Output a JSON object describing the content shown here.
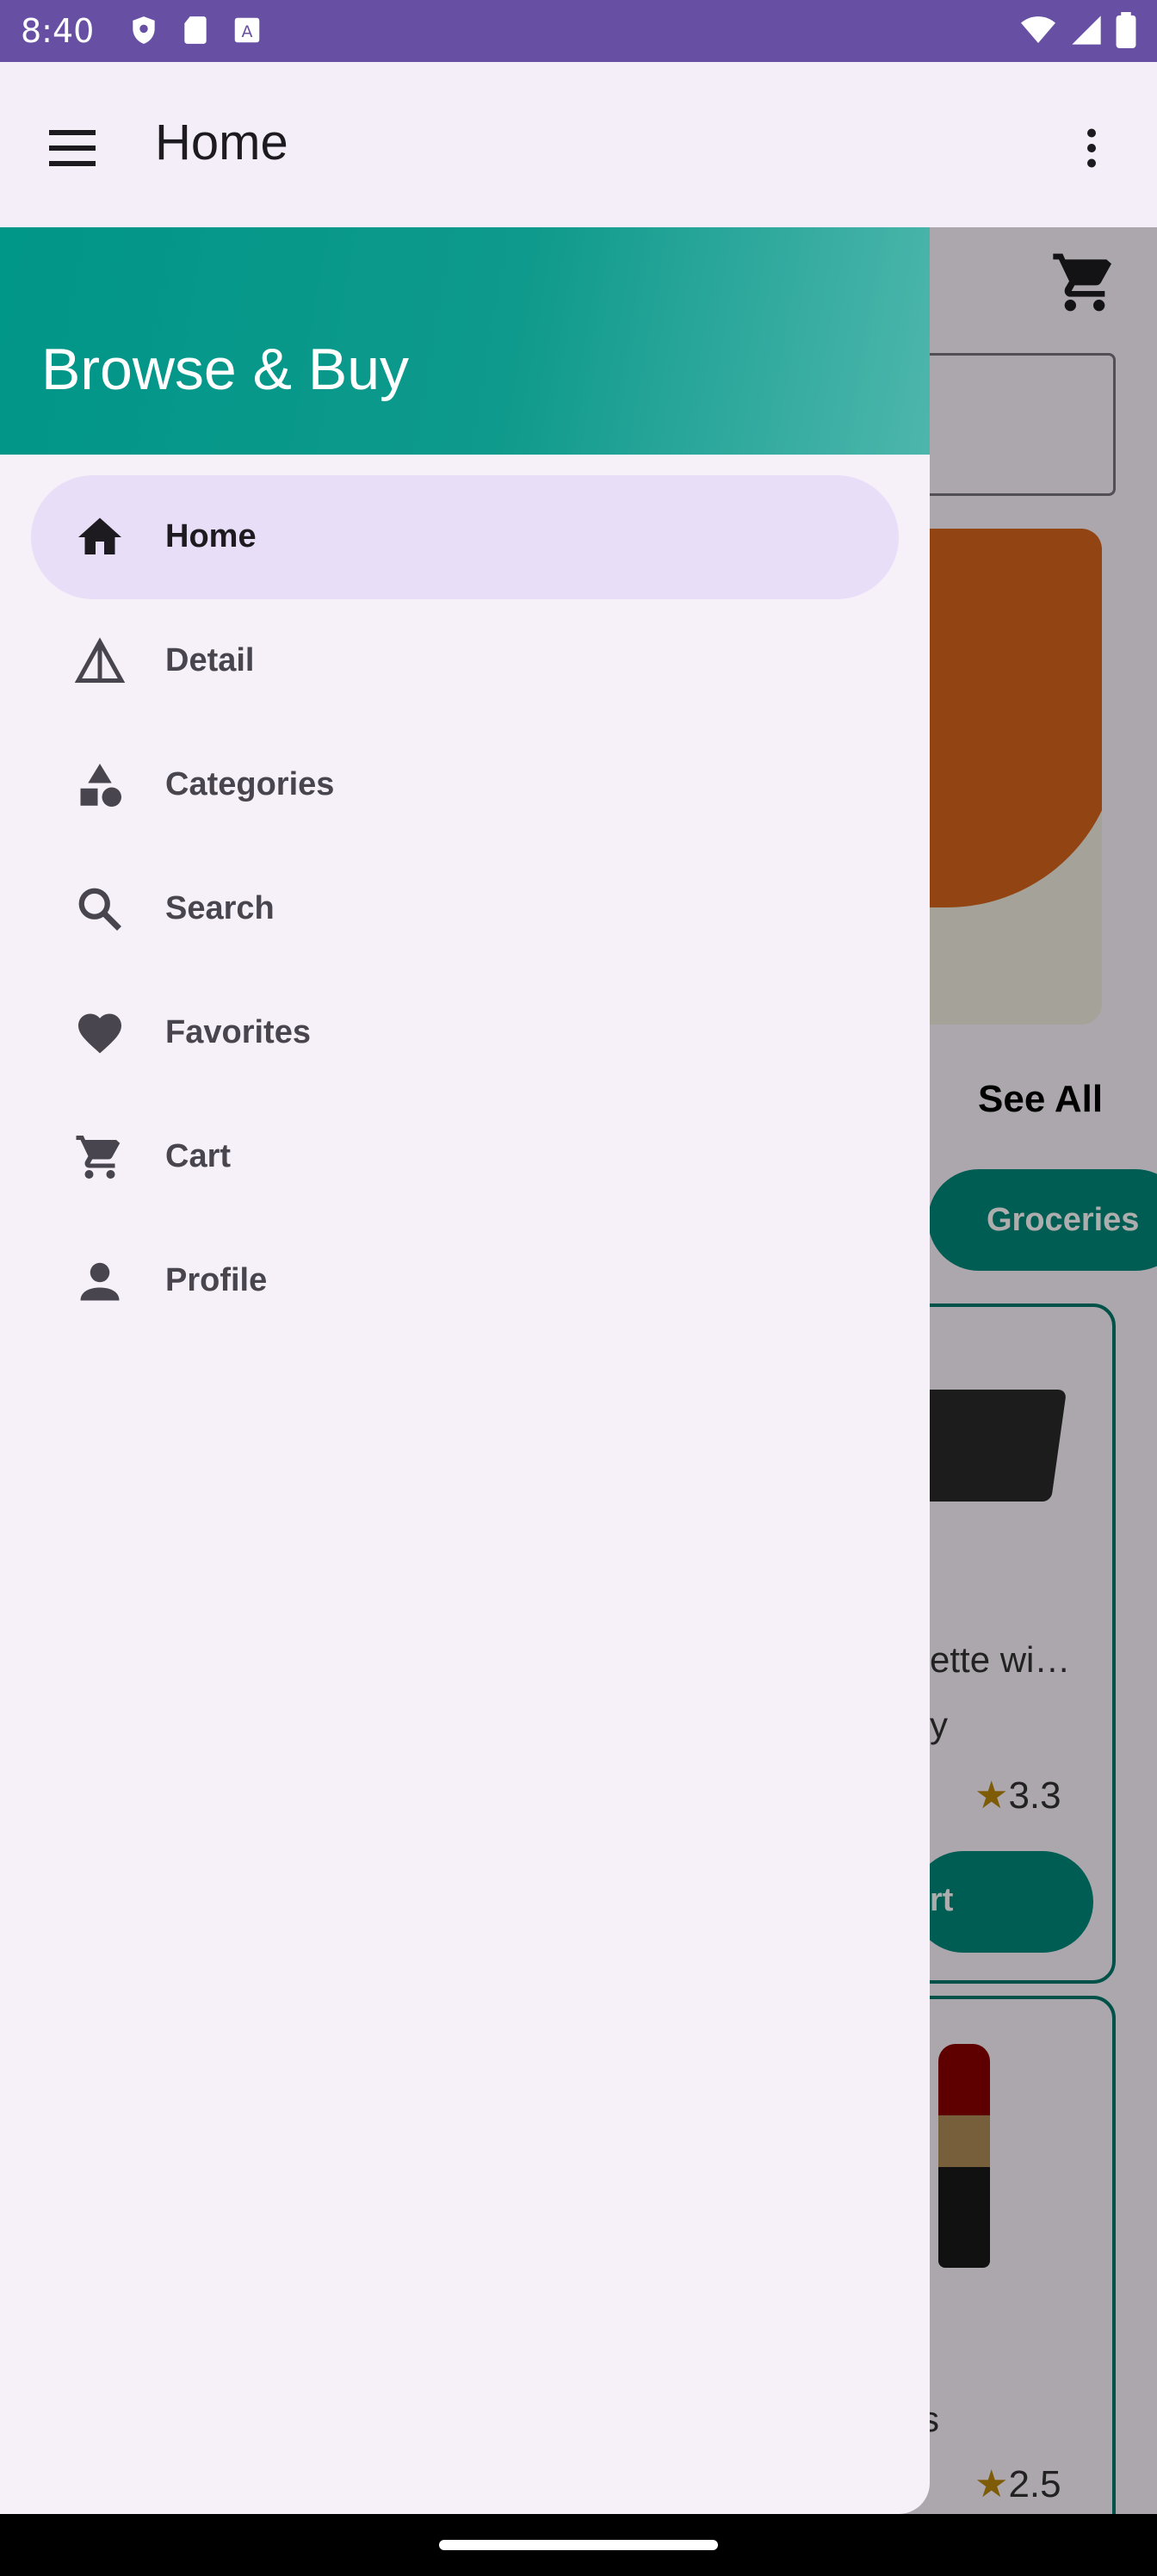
{
  "status_bar": {
    "time": "8:40",
    "icons": [
      "shield-icon",
      "sd-card-icon",
      "keyboard-a-icon",
      "wifi-icon",
      "signal-icon",
      "battery-icon"
    ]
  },
  "app_bar": {
    "title": "Home",
    "menu_icon": "hamburger-menu-icon",
    "more_icon": "more-vert-icon"
  },
  "drawer": {
    "header_title": "Browse & Buy",
    "items": [
      {
        "label": "Home",
        "icon": "home-icon",
        "selected": true
      },
      {
        "label": "Detail",
        "icon": "warning-triangle-icon",
        "selected": false
      },
      {
        "label": "Categories",
        "icon": "category-shapes-icon",
        "selected": false
      },
      {
        "label": "Search",
        "icon": "search-icon",
        "selected": false
      },
      {
        "label": "Favorites",
        "icon": "heart-icon",
        "selected": false
      },
      {
        "label": "Cart",
        "icon": "cart-icon",
        "selected": false
      },
      {
        "label": "Profile",
        "icon": "person-icon",
        "selected": false
      }
    ]
  },
  "background_page": {
    "see_all": "See All",
    "chip_label": "Groceries",
    "card1_title_fragment": "ette wi…",
    "card1_subtitle_fragment": "y",
    "card1_rating": "3.3",
    "card1_button_fragment": "rt",
    "card2_title_fragment": "s",
    "card2_rating": "2.5"
  },
  "colors": {
    "status_bar": "#6750A4",
    "app_bar": "#F3EEF7",
    "drawer_bg": "#F6F1F8",
    "header_teal": "#009688",
    "selected_item": "#E8DEF8",
    "star": "#B8860B"
  }
}
